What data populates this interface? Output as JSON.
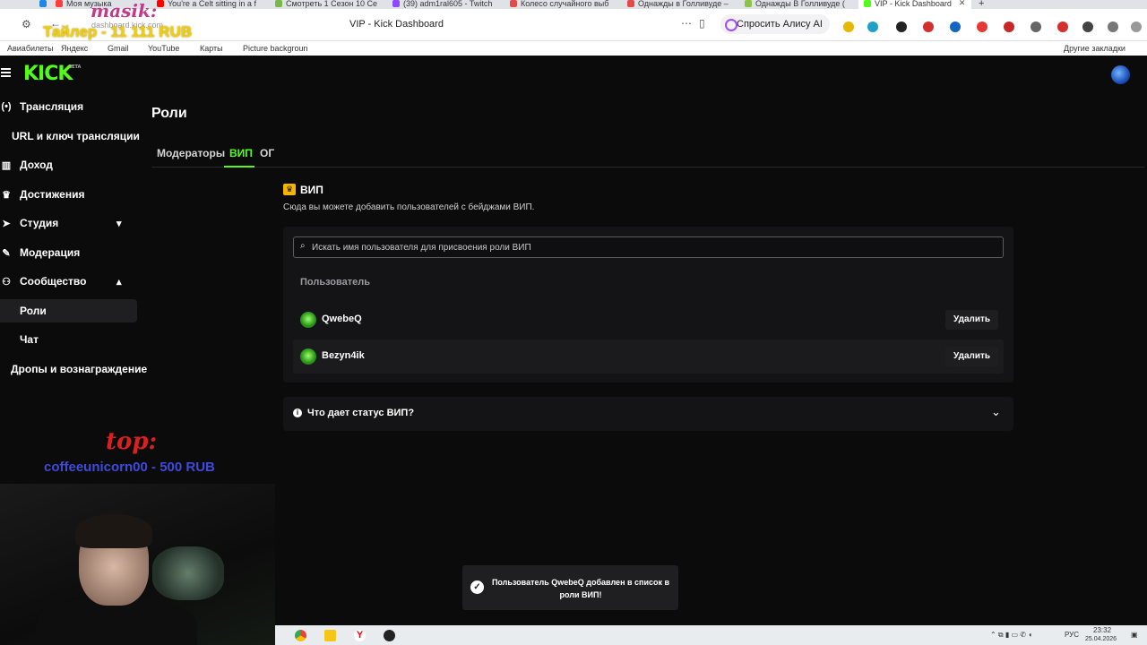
{
  "browser": {
    "tabs": [
      {
        "label": "Моя музыка",
        "color": "#ff3d3d"
      },
      {
        "label": "You're a Celt sitting in a f",
        "color": "#ff0000"
      },
      {
        "label": "Смотреть 1 Сезон 10 Се",
        "color": "#7ab648"
      },
      {
        "label": "(39) adm1ral605 - Twitch",
        "color": "#9146ff"
      },
      {
        "label": "Колесо случайного выб",
        "color": "#e14b4b"
      },
      {
        "label": "Однажды в Голливуде –",
        "color": "#e14b4b"
      },
      {
        "label": "Однажды В Голливуде (",
        "color": "#8bc34a"
      },
      {
        "label": "VIP - Kick Dashboard",
        "color": "#53fc18"
      }
    ],
    "address_url": "dashboard.kick.com",
    "page_title": "VIP - Kick Dashboard",
    "alice_button": "Спросить Алису AI",
    "bookmarks": [
      "Авиабилеты",
      "Яндекс",
      "Gmail",
      "YouTube",
      "Карты",
      "Picture backgroun"
    ],
    "other_bookmarks": "Другие закладки"
  },
  "app": {
    "logo": "KICK",
    "logo_badge": "BETA",
    "accent": "#53fc18"
  },
  "sidebar": {
    "items": [
      {
        "label": "Трансляция",
        "icon": "broadcast-icon",
        "glyph": "(•)"
      },
      {
        "label": "URL и ключ трансляции",
        "icon": "",
        "glyph": ""
      },
      {
        "label": "Доход",
        "icon": "chart-icon",
        "glyph": "▥"
      },
      {
        "label": "Достижения",
        "icon": "trophy-icon",
        "glyph": "🏆"
      },
      {
        "label": "Студия",
        "icon": "studio-icon",
        "glyph": "➤",
        "chevron": "down"
      },
      {
        "label": "Модерация",
        "icon": "wrench-icon",
        "glyph": "🔧"
      },
      {
        "label": "Сообщество",
        "icon": "community-icon",
        "glyph": "👥",
        "chevron": "up"
      },
      {
        "label": "Роли",
        "active": true
      },
      {
        "label": "Чат"
      },
      {
        "label": "Дропы и вознаграждение"
      }
    ]
  },
  "main": {
    "title": "Роли",
    "tabs": [
      {
        "label": "Модераторы"
      },
      {
        "label": "ВИП",
        "active": true
      },
      {
        "label": "ОГ"
      }
    ],
    "section_title": "ВИП",
    "section_desc": "Сюда вы можете добавить пользователей с бейджами ВИП.",
    "search_placeholder": "Искать имя пользователя для присвоения роли ВИП",
    "column_header": "Пользователь",
    "users": [
      {
        "name": "QwebeQ",
        "action": "Удалить"
      },
      {
        "name": "Bezyn4ik",
        "action": "Удалить"
      }
    ],
    "faq": "Что дает статус ВИП?"
  },
  "toast": {
    "message": "Пользователь QwebeQ добавлен в список в роли ВИП!"
  },
  "overlay": {
    "masik": "masik:",
    "trailer": "Тайлер - 11 111 RUB",
    "top": "top:",
    "top_donor": "coffeeunicorn00 - 500 RUB"
  },
  "taskbar": {
    "lang": "РУС",
    "time": "23:32",
    "date": "25.04.2026"
  }
}
